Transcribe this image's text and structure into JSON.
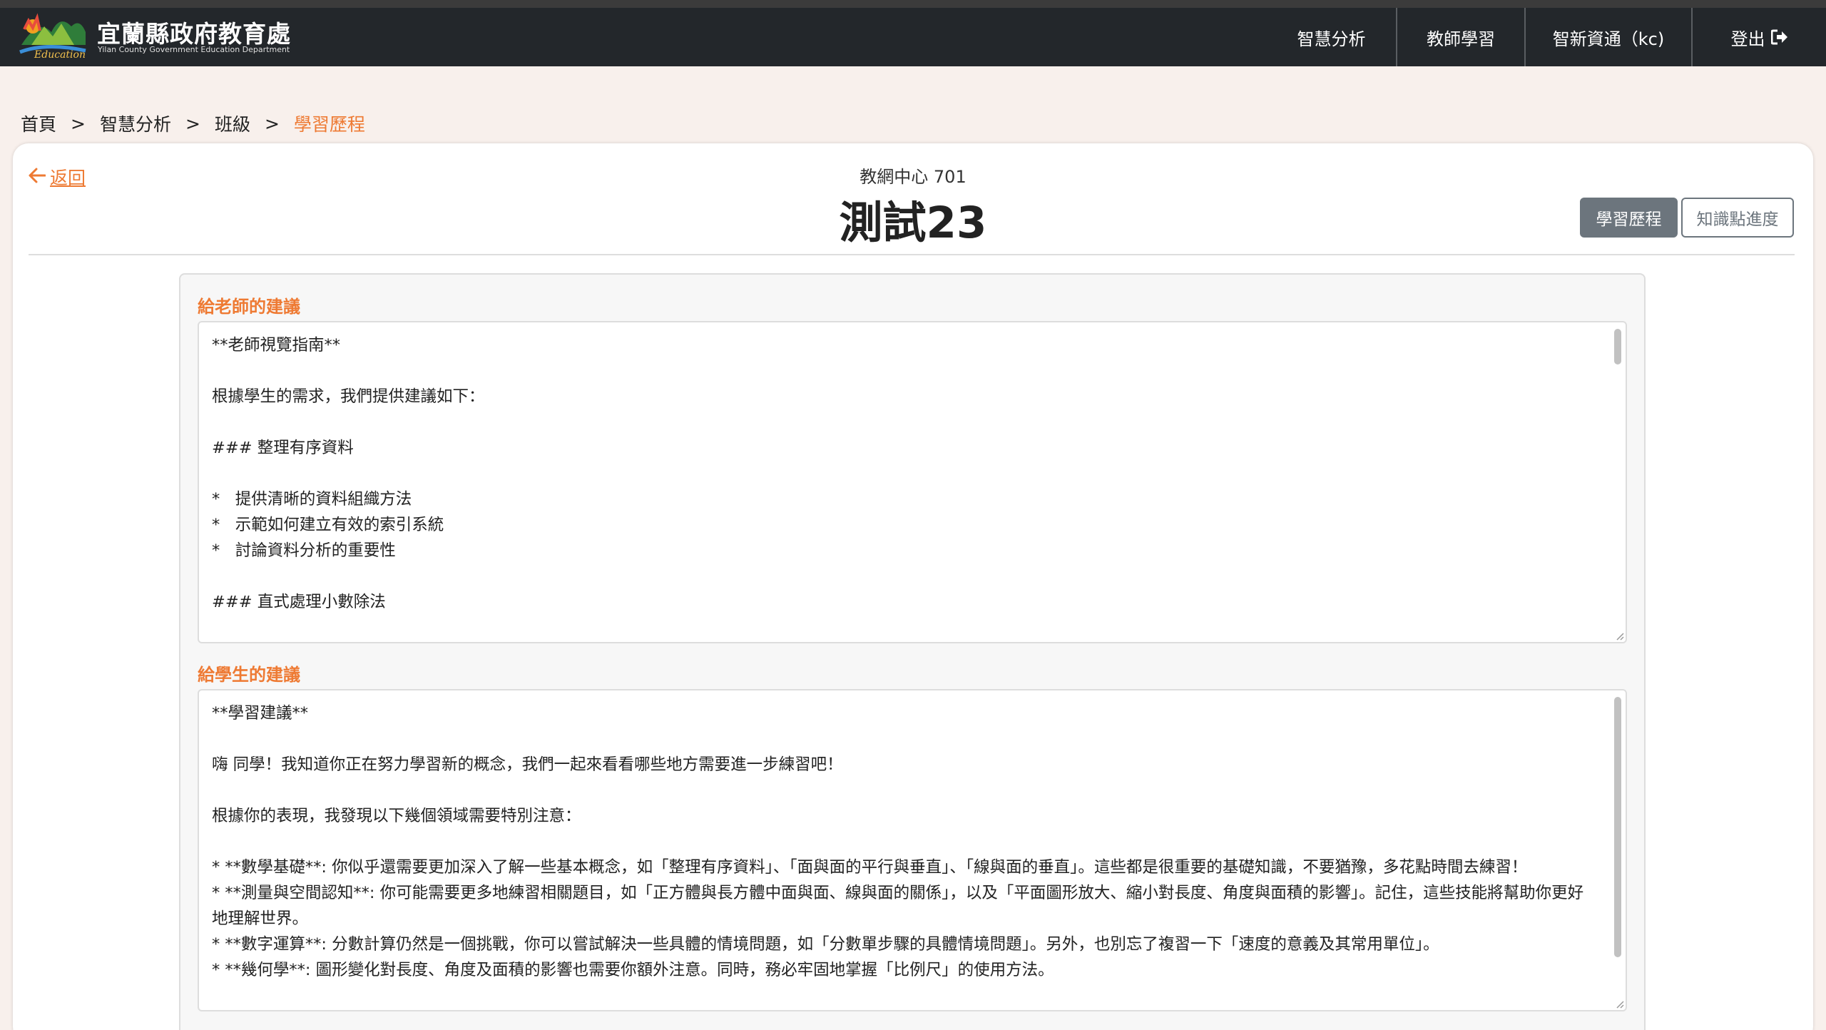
{
  "header": {
    "brand_name": "宜蘭縣政府教育處",
    "brand_subtitle": "Yilan County Government Education Department",
    "logo_text": "Education",
    "nav": [
      {
        "label": "智慧分析"
      },
      {
        "label": "教師學習"
      },
      {
        "label": "智新資通（kc)"
      },
      {
        "label": "登出"
      }
    ]
  },
  "breadcrumb": {
    "items": [
      "首頁",
      "智慧分析",
      "班級"
    ],
    "current": "學習歷程",
    "separator": ">"
  },
  "page": {
    "back_label": "返回",
    "subtitle": "教網中心 701",
    "title": "測試23",
    "tabs": [
      {
        "label": "學習歷程",
        "active": true
      },
      {
        "label": "知識點進度",
        "active": false
      }
    ]
  },
  "teacher_advice": {
    "label": "給老師的建議",
    "text": "**老師視覽指南**\n\n根據學生的需求，我們提供建議如下：\n\n### 整理有序資料\n\n*   提供清晰的資料組織方法\n*   示範如何建立有效的索引系統\n*   討論資料分析的重要性\n\n### 直式處理小數除法\n\n*   示範使用直式計算的小數除法技巧"
  },
  "student_advice": {
    "label": "給學生的建議",
    "text": "**學習建議**\n\n嗨 同學！我知道你正在努力學習新的概念，我們一起來看看哪些地方需要進一步練習吧！\n\n根據你的表現，我發現以下幾個領域需要特別注意：\n\n* **數學基礎**: 你似乎還需要更加深入了解一些基本概念，如「整理有序資料」、「面與面的平行與垂直」、「線與面的垂直」。這些都是很重要的基礎知識，不要猶豫，多花點時間去練習！\n* **測量與空間認知**: 你可能需要更多地練習相關題目，如「正方體與長方體中面與面、線與面的關係」，以及「平面圖形放大、縮小對長度、角度與面積的影響」。記住，這些技能將幫助你更好地理解世界。\n* **數字運算**: 分數計算仍然是一個挑戰，你可以嘗試解決一些具體的情境問題，如「分數單步驟的具體情境問題」。另外，也別忘了複習一下「速度的意義及其常用單位」。\n* **幾何學**: 圖形變化對長度、角度及面積的影響也需要你額外注意。同時，務必牢固地掌握「比例尺」的使用方法。"
  },
  "colors": {
    "accent": "#ee7a33",
    "navbar": "#23272b",
    "page_bg": "#f8f0ec",
    "button_active": "#6c757d"
  },
  "icons": {
    "back": "arrow-left-icon",
    "logout": "sign-out-icon",
    "logo": "yilan-education-logo"
  }
}
